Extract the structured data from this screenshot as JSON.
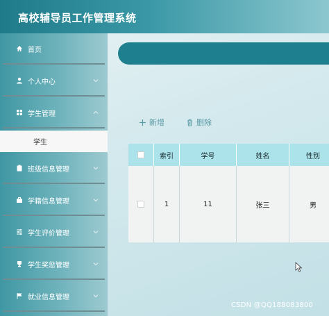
{
  "header": {
    "title": "高校辅导员工作管理系统"
  },
  "sidebar": {
    "items": [
      {
        "label": "首页",
        "icon": "home-icon"
      },
      {
        "label": "个人中心",
        "icon": "user-icon"
      },
      {
        "label": "学生管理",
        "icon": "grid-icon"
      },
      {
        "label": "班级信息管理",
        "icon": "clipboard-icon"
      },
      {
        "label": "学籍信息管理",
        "icon": "briefcase-icon"
      },
      {
        "label": "学生评价管理",
        "icon": "sliders-icon"
      },
      {
        "label": "学生奖惩管理",
        "icon": "trophy-icon"
      },
      {
        "label": "就业信息管理",
        "icon": "flag-icon"
      }
    ],
    "active_sub_item": "学生"
  },
  "toolbar": {
    "add_label": "新增",
    "delete_label": "删除"
  },
  "table": {
    "columns": [
      "索引",
      "学号",
      "姓名",
      "性别"
    ],
    "rows": [
      {
        "index": "1",
        "student_id": "11",
        "name": "张三",
        "gender": "男"
      }
    ]
  },
  "watermark": "CSDN @QQ188083800",
  "colors": {
    "header": "#1f7a89",
    "accent": "#1e7f8e",
    "table_header": "#ace3ea"
  }
}
